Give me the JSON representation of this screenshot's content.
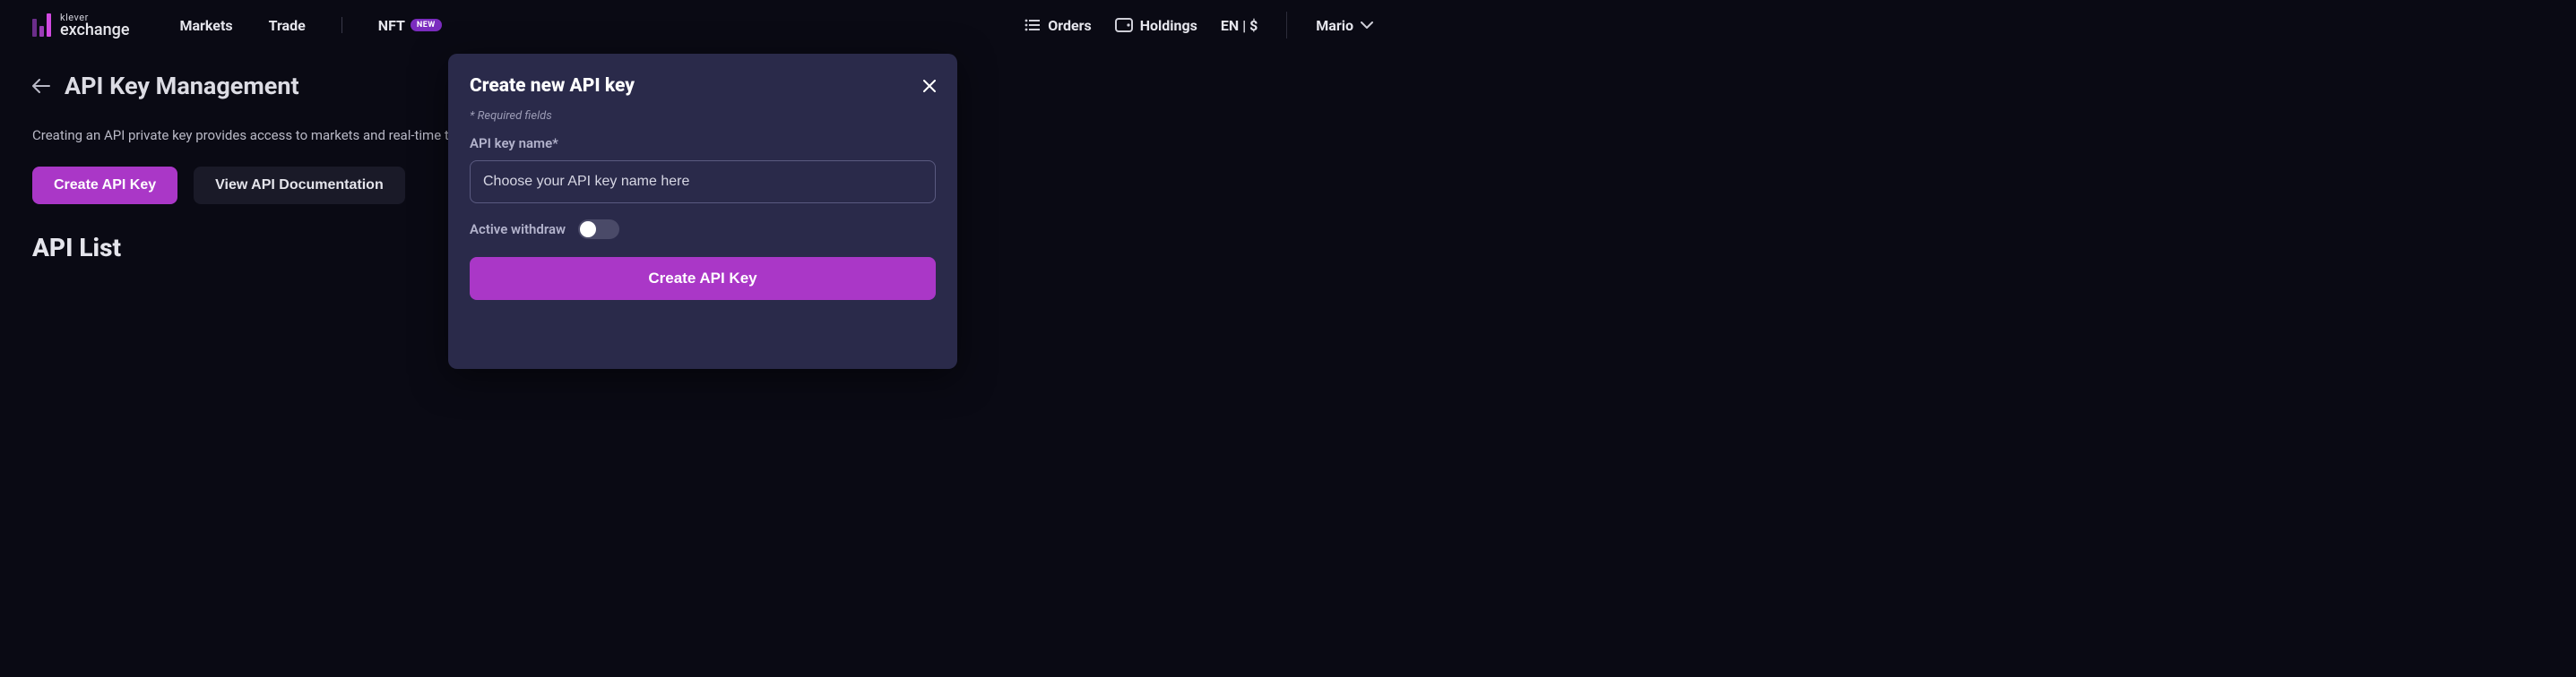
{
  "brand": {
    "top": "klever",
    "bottom": "exchange"
  },
  "nav": {
    "markets": "Markets",
    "trade": "Trade",
    "nft": "NFT",
    "nft_badge": "NEW"
  },
  "header_right": {
    "orders": "Orders",
    "holdings": "Holdings",
    "locale": "EN | $",
    "user": "Mario"
  },
  "page": {
    "title": "API Key Management",
    "description": "Creating an API private key provides access to markets and real-time tr",
    "create_btn": "Create API Key",
    "docs_btn": "View API Documentation",
    "list_title": "API List"
  },
  "modal": {
    "title": "Create new API key",
    "required_note": "* Required fields",
    "name_label": "API key name*",
    "name_placeholder": "Choose your API key name here",
    "toggle_label": "Active withdraw",
    "submit": "Create API Key"
  }
}
